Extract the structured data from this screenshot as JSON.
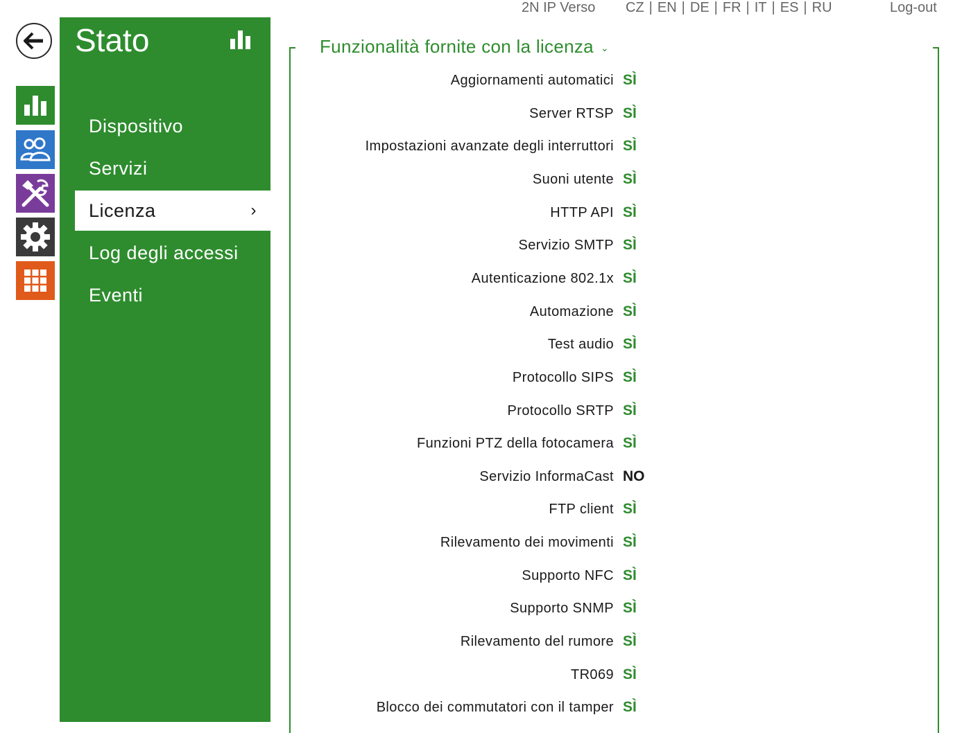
{
  "header": {
    "device_name": "2N IP Verso",
    "languages": [
      "CZ",
      "EN",
      "DE",
      "FR",
      "IT",
      "ES",
      "RU"
    ],
    "logout": "Log-out"
  },
  "rail": {
    "icons": [
      "back-arrow-icon",
      "bar-chart-icon",
      "users-icon",
      "tools-icon",
      "gear-icon",
      "grid-icon"
    ],
    "colors": {
      "status": "#2e8c2e",
      "users": "#2f77c9",
      "tools": "#7a3c9a",
      "settings": "#3a3a3a",
      "apps": "#e05a1b"
    }
  },
  "menu": {
    "title": "Stato",
    "items": [
      {
        "label": "Dispositivo"
      },
      {
        "label": "Servizi"
      },
      {
        "label": "Licenza",
        "active": true
      },
      {
        "label": "Log degli accessi"
      },
      {
        "label": "Eventi"
      }
    ]
  },
  "content": {
    "section_title": "Funzionalità fornite con la licenza",
    "features": [
      {
        "label": "Aggiornamenti automatici",
        "value": "SÌ"
      },
      {
        "label": "Server RTSP",
        "value": "SÌ"
      },
      {
        "label": "Impostazioni avanzate degli interruttori",
        "value": "SÌ"
      },
      {
        "label": "Suoni utente",
        "value": "SÌ"
      },
      {
        "label": "HTTP API",
        "value": "SÌ"
      },
      {
        "label": "Servizio SMTP",
        "value": "SÌ"
      },
      {
        "label": "Autenticazione 802.1x",
        "value": "SÌ"
      },
      {
        "label": "Automazione",
        "value": "SÌ"
      },
      {
        "label": "Test audio",
        "value": "SÌ"
      },
      {
        "label": "Protocollo SIPS",
        "value": "SÌ"
      },
      {
        "label": "Protocollo SRTP",
        "value": "SÌ"
      },
      {
        "label": "Funzioni PTZ della fotocamera",
        "value": "SÌ"
      },
      {
        "label": "Servizio InformaCast",
        "value": "NO"
      },
      {
        "label": "FTP client",
        "value": "SÌ"
      },
      {
        "label": "Rilevamento dei movimenti",
        "value": "SÌ"
      },
      {
        "label": "Supporto NFC",
        "value": "SÌ"
      },
      {
        "label": "Supporto SNMP",
        "value": "SÌ"
      },
      {
        "label": "Rilevamento del rumore",
        "value": "SÌ"
      },
      {
        "label": "TR069",
        "value": "SÌ"
      },
      {
        "label": "Blocco dei commutatori con il tamper",
        "value": "SÌ"
      }
    ]
  }
}
